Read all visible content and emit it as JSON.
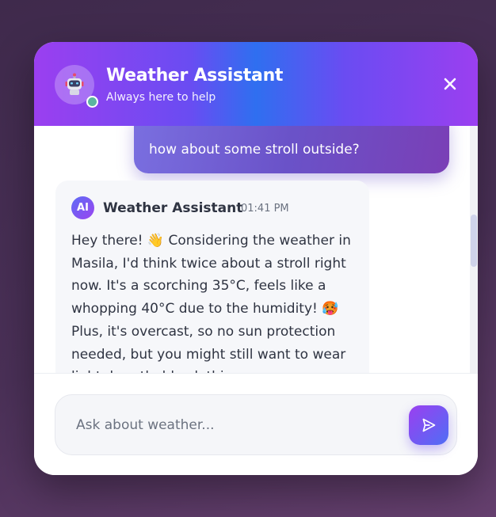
{
  "header": {
    "title": "Weather Assistant",
    "subtitle": "Always here to help",
    "avatar_icon": "robot-icon",
    "close_icon": "close-icon",
    "online_color": "#5bb5a0"
  },
  "messages": [
    {
      "role": "user",
      "text": "how about some stroll outside?"
    },
    {
      "role": "assistant",
      "avatar_label": "AI",
      "sender": "Weather Assistant",
      "time": "01:41 PM",
      "text": "Hey there! 👋 Considering the weather in Masila, I'd think twice about a stroll right now. It's a scorching 35°C, feels like a whopping 40°C due to the humidity! 🥵 Plus, it's overcast, so no sun protection needed, but you might still want to wear light, breathable clothing."
    }
  ],
  "composer": {
    "placeholder": "Ask about weather...",
    "send_icon": "send-icon"
  },
  "colors": {
    "brand_purple": "#9b3ff0",
    "brand_blue": "#2f6ff0",
    "user_bubble": "#6a52c8"
  }
}
